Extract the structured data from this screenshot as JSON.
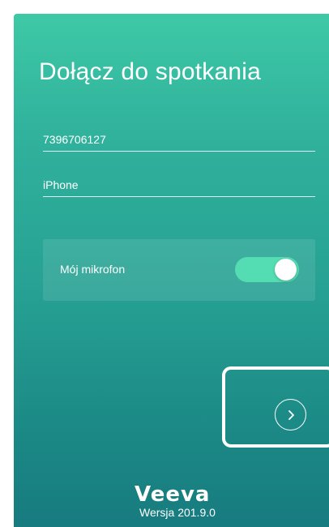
{
  "screen": {
    "title": "Dołącz do spotkania",
    "meeting_id_field": {
      "value": "7396706127"
    },
    "name_field": {
      "value": "iPhone"
    },
    "microphone": {
      "label": "Mój mikrofon",
      "enabled": true
    },
    "next_button": {
      "icon": "chevron-right-icon"
    },
    "brand": {
      "logo_text": "Veeva"
    },
    "version_text": "Wersja 201.9.0"
  },
  "colors": {
    "gradient_top": "#3ec9a6",
    "gradient_bottom": "#177b7f",
    "toggle_on": "#54ddb2",
    "text": "#ffffff"
  }
}
